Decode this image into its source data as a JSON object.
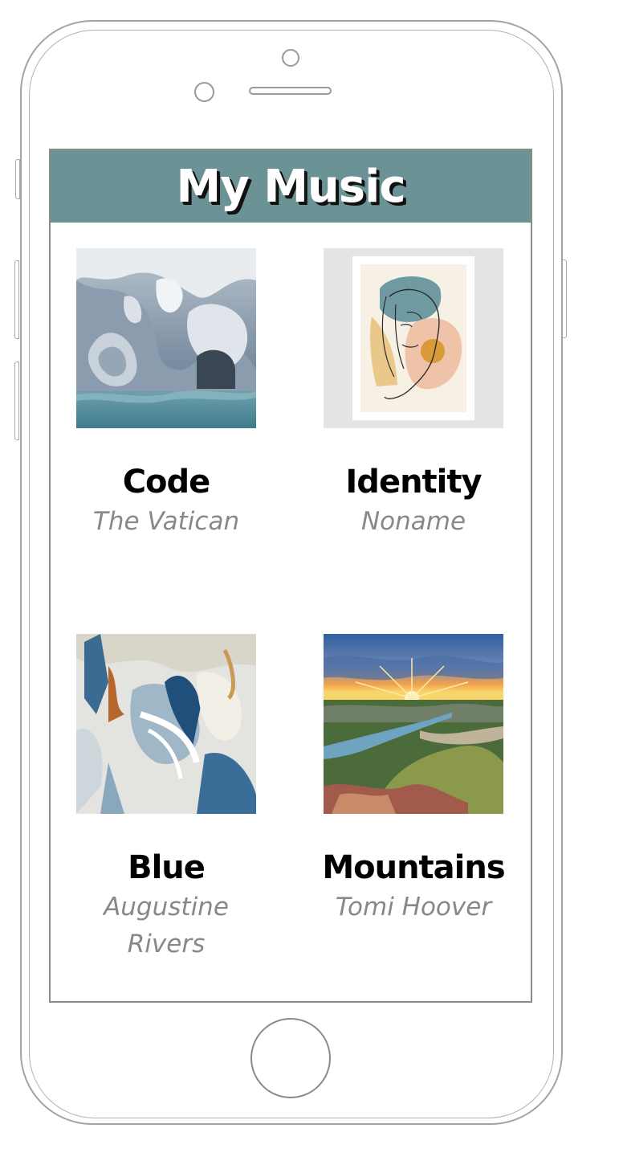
{
  "app": {
    "title": "My Music"
  },
  "albums": [
    {
      "title": "Code",
      "artist": "The Vatican",
      "art_icon": "marble-cave-art"
    },
    {
      "title": "Identity",
      "artist": "Noname",
      "art_icon": "abstract-face-art"
    },
    {
      "title": "Blue",
      "artist": "Augustine Rivers",
      "art_icon": "blue-abstract-paint-art"
    },
    {
      "title": "Mountains",
      "artist": "Tomi Hoover",
      "art_icon": "sunset-valley-art"
    }
  ],
  "colors": {
    "header": "#6b9396",
    "artist_text": "#888888"
  }
}
